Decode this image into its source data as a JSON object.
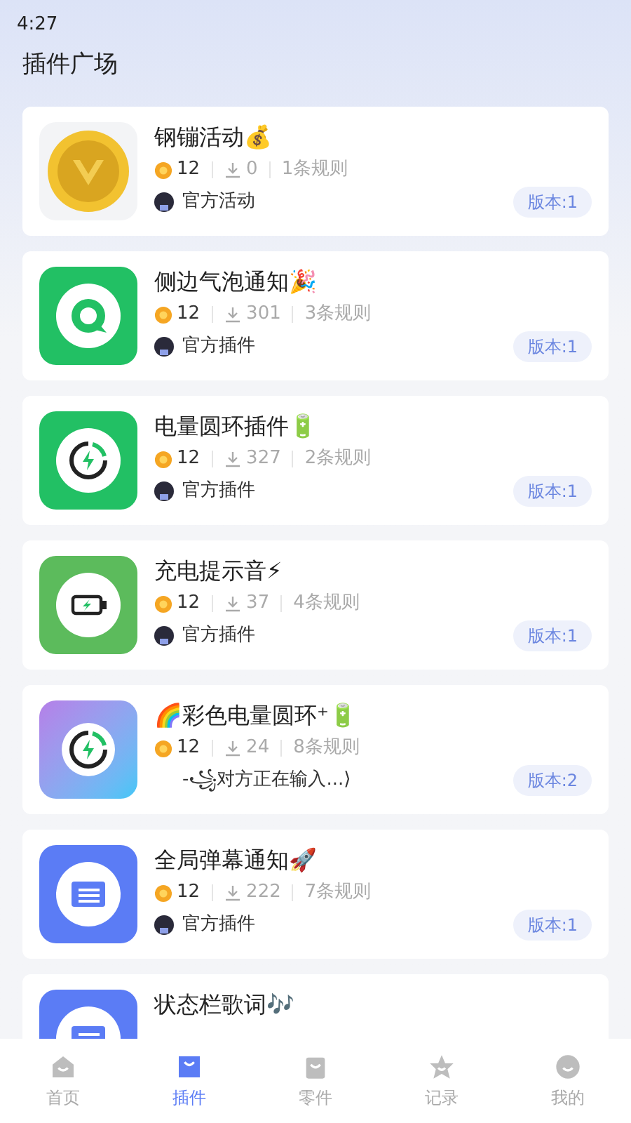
{
  "status_bar": {
    "time": "4:27"
  },
  "header": {
    "title": "插件广场"
  },
  "plugins": [
    {
      "kind": "coin",
      "title": "钢镚活动💰",
      "coins": "12",
      "downloads": "0",
      "rules": "1条规则",
      "author": "官方活动",
      "avatar": true,
      "version": "版本:1"
    },
    {
      "kind": "bubble",
      "title": "侧边气泡通知🎉",
      "coins": "12",
      "downloads": "301",
      "rules": "3条规则",
      "author": "官方插件",
      "avatar": true,
      "version": "版本:1"
    },
    {
      "kind": "ring",
      "title": "电量圆环插件🔋",
      "coins": "12",
      "downloads": "327",
      "rules": "2条规则",
      "author": "官方插件",
      "avatar": true,
      "version": "版本:1"
    },
    {
      "kind": "battery",
      "title": "充电提示音⚡",
      "coins": "12",
      "downloads": "37",
      "rules": "4条规则",
      "author": "官方插件",
      "avatar": true,
      "version": "版本:1"
    },
    {
      "kind": "gradient-ring",
      "title": "🌈彩色电量圆环⁺🔋",
      "coins": "12",
      "downloads": "24",
      "rules": "8条规则",
      "author": "-꧁对方正在输入...⟩",
      "avatar": false,
      "version": "版本:2"
    },
    {
      "kind": "list",
      "title": "全局弹幕通知🚀",
      "coins": "12",
      "downloads": "222",
      "rules": "7条规则",
      "author": "官方插件",
      "avatar": true,
      "version": "版本:1"
    },
    {
      "kind": "list",
      "title": "状态栏歌词🎶"
    }
  ],
  "nav": [
    {
      "kind": "home",
      "label": "首页",
      "selected": false
    },
    {
      "kind": "plugin",
      "label": "插件",
      "selected": true
    },
    {
      "kind": "bag",
      "label": "零件",
      "selected": false
    },
    {
      "kind": "star",
      "label": "记录",
      "selected": false
    },
    {
      "kind": "face",
      "label": "我的",
      "selected": false
    }
  ]
}
